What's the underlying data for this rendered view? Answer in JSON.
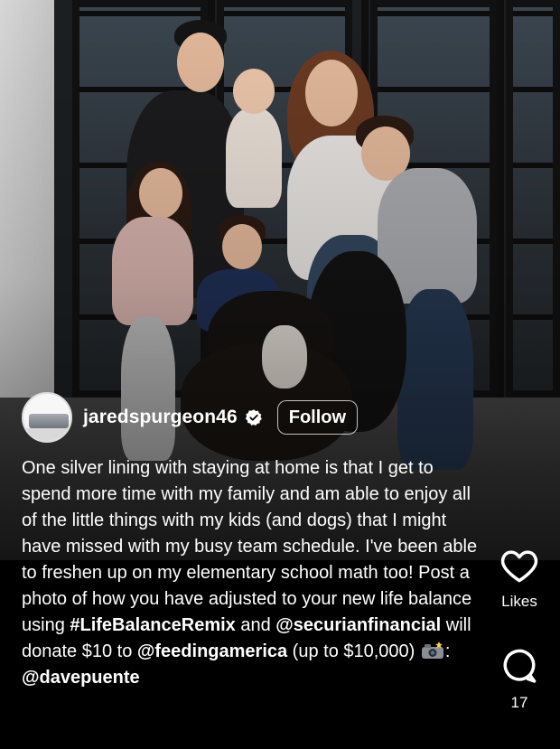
{
  "post": {
    "username": "jaredspurgeon46",
    "verified": true,
    "follow_label": "Follow",
    "caption": {
      "part1": "One silver lining with staying at home is that I get to spend more time with my family and am able to enjoy all of the little things with my kids (and dogs) that I might have missed with my busy team schedule. I've been able to freshen up on my elementary school math too! Post a photo of how you have adjusted to your new life balance using ",
      "hashtag": "#LifeBalanceRemix",
      "part2": " and ",
      "mention1": "@securianfinancial",
      "part3": " will donate $10 to ",
      "mention2": "@feedingamerica",
      "part4": " (up to $10,000) ",
      "part5": ": ",
      "mention3": "@davepuente"
    }
  },
  "actions": {
    "like": {
      "icon": "heart-icon",
      "label": "Likes"
    },
    "comment": {
      "icon": "comment-icon",
      "label": "17"
    }
  },
  "colors": {
    "background": "#000000",
    "text": "#ffffff",
    "verified_badge": "#ffffff"
  }
}
